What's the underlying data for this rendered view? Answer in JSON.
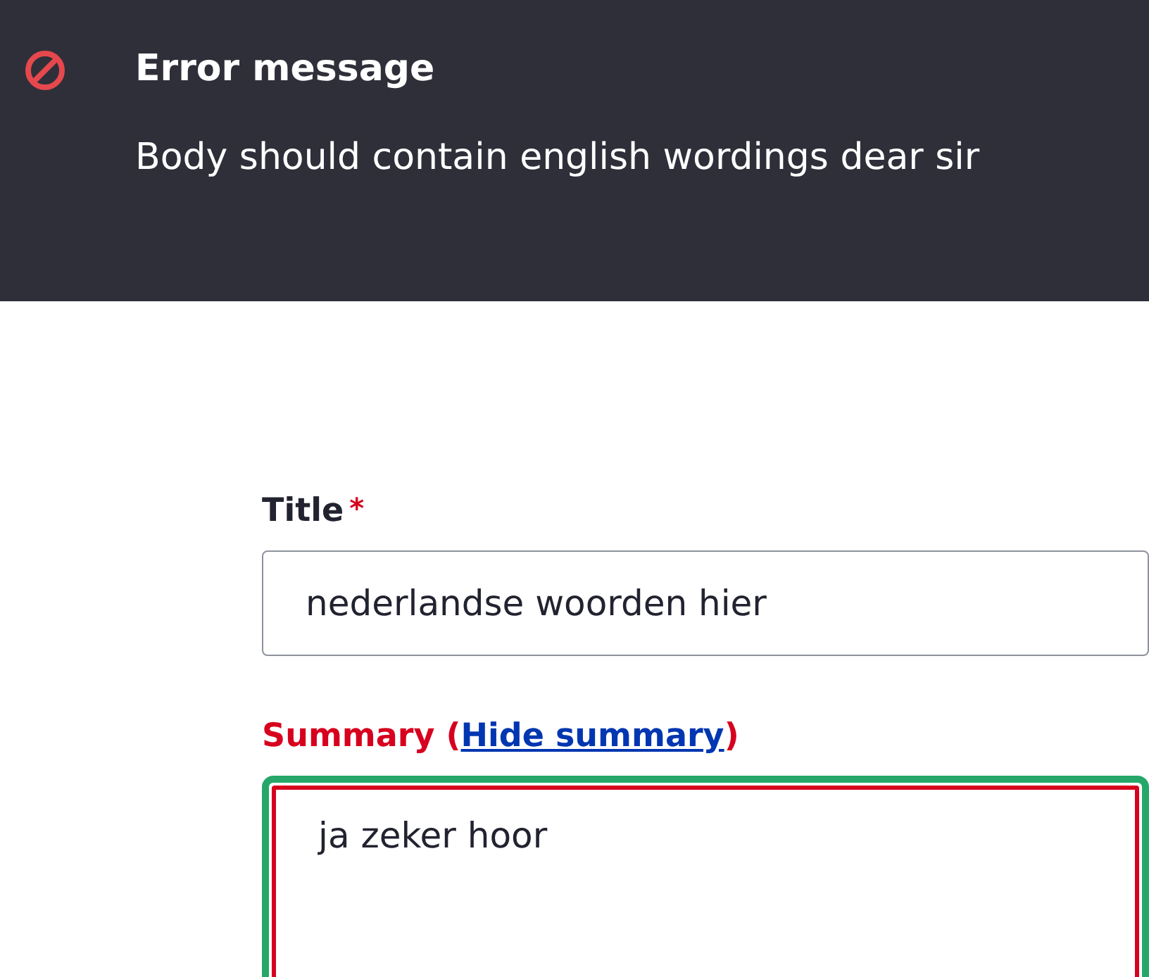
{
  "message": {
    "kind": "error",
    "title": "Error message",
    "text": "Body should contain english wordings dear sir"
  },
  "fields": [
    {
      "kind": "input",
      "label": "Title",
      "required_mark": "*",
      "value": "nederlandse woorden hier",
      "error": false,
      "focused": false
    },
    {
      "kind": "textarea",
      "label": "Summary (",
      "link": "Hide summary",
      "label_end": ")",
      "value": "ja zeker hoor",
      "error": true,
      "focused": true
    }
  ]
}
